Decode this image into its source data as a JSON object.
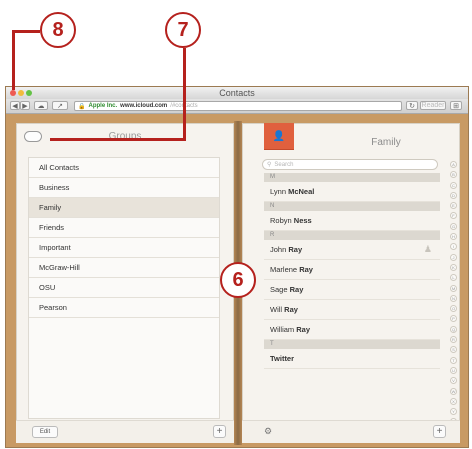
{
  "callouts": {
    "window": "8",
    "groups_button": "7",
    "contacts_list": "6"
  },
  "window": {
    "title": "Contacts"
  },
  "browser": {
    "secure_label": "Apple Inc.",
    "host": "www.icloud.com",
    "path": "/#contacts",
    "reader_label": "Reader"
  },
  "groups_page": {
    "title": "Groups",
    "items": [
      "All Contacts",
      "Business",
      "Family",
      "Friends",
      "Important",
      "McGraw-Hill",
      "OSU",
      "Pearson"
    ],
    "selected": "Family",
    "edit_label": "Edit",
    "add_symbol": "+"
  },
  "contacts_page": {
    "title": "Family",
    "search_placeholder": "Search",
    "sections": [
      {
        "letter": "M",
        "contacts": [
          {
            "first": "Lynn",
            "last": "McNeal"
          }
        ]
      },
      {
        "letter": "N",
        "contacts": [
          {
            "first": "Robyn",
            "last": "Ness"
          }
        ]
      },
      {
        "letter": "R",
        "contacts": [
          {
            "first": "John",
            "last": "Ray"
          },
          {
            "first": "Marlene",
            "last": "Ray"
          },
          {
            "first": "Sage",
            "last": "Ray"
          },
          {
            "first": "Will",
            "last": "Ray"
          },
          {
            "first": "William",
            "last": "Ray"
          }
        ]
      },
      {
        "letter": "T",
        "contacts": [
          {
            "first": "",
            "last": "Twitter"
          }
        ]
      }
    ],
    "alphabet": [
      "A",
      "B",
      "C",
      "D",
      "E",
      "F",
      "G",
      "H",
      "I",
      "J",
      "K",
      "L",
      "M",
      "N",
      "O",
      "P",
      "Q",
      "R",
      "S",
      "T",
      "U",
      "V",
      "W",
      "X",
      "Y",
      "Z",
      "#"
    ],
    "add_symbol": "+"
  },
  "icons": {
    "gear": "gear-icon",
    "person": "person-icon",
    "cloud": "cloud-icon",
    "bookmark": "contact-card-icon",
    "search": "search-icon"
  },
  "colors": {
    "callout": "#b5211d",
    "book_cover": "#c89a64",
    "bookmark": "#e0603e",
    "page": "#f6f3ee"
  }
}
